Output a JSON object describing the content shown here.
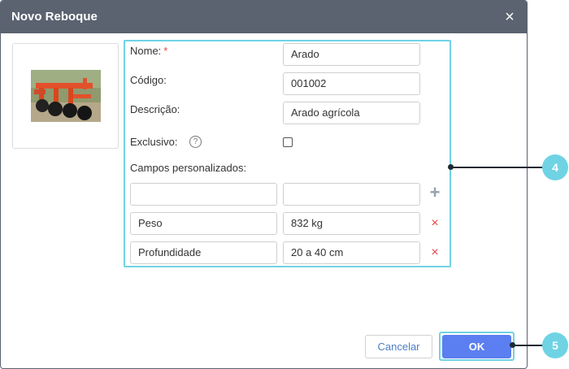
{
  "dialog": {
    "title": "Novo Reboque",
    "close_symbol": "×"
  },
  "image": {
    "alt_icon": "trailer-plow-photo"
  },
  "form": {
    "name_label": "Nome:",
    "required_mark": "*",
    "name_value": "Arado",
    "code_label": "Código:",
    "code_value": "001002",
    "description_label": "Descrição:",
    "description_value": "Arado agrícola",
    "exclusive_label": "Exclusivo:",
    "exclusive_checked": false,
    "help_symbol": "?",
    "custom_fields_label": "Campos personalizados:",
    "new_field_name": "",
    "new_field_value": "",
    "add_symbol": "+",
    "delete_symbol": "×",
    "custom_fields": [
      {
        "name": "Peso",
        "value": "832 kg"
      },
      {
        "name": "Profundidade",
        "value": "20 a 40 cm"
      }
    ]
  },
  "buttons": {
    "cancel_label": "Cancelar",
    "ok_label": "OK"
  },
  "callouts": [
    {
      "label": "4"
    },
    {
      "label": "5"
    }
  ],
  "colors": {
    "titlebar": "#5b6270",
    "accent_outline": "#6fd3e4",
    "ok_button": "#5b7ff0",
    "delete_icon": "#e64545"
  }
}
